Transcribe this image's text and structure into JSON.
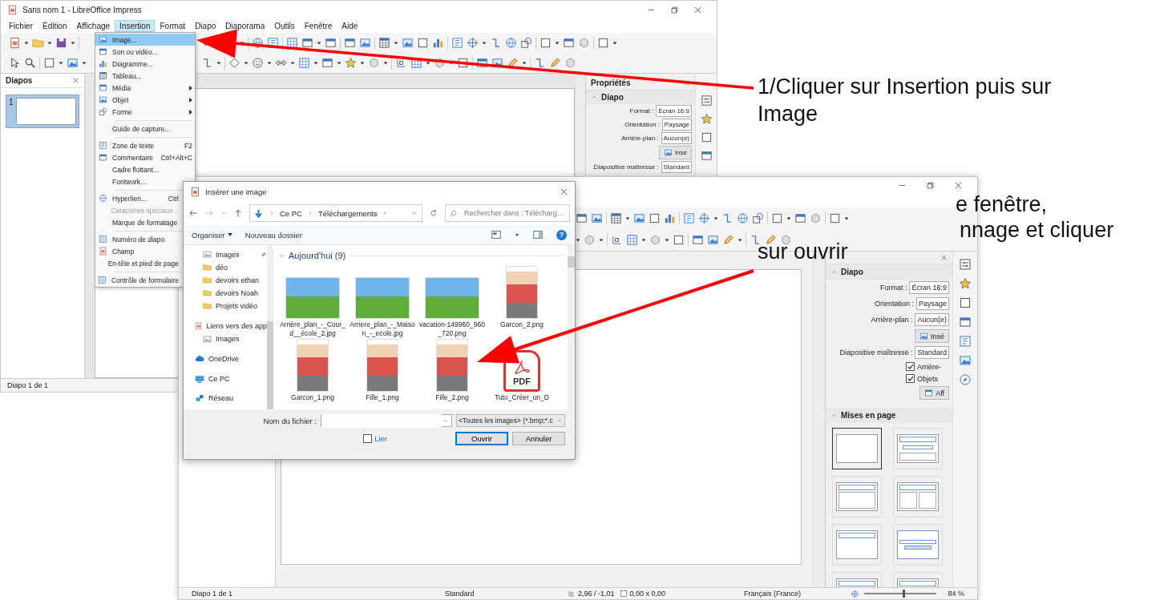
{
  "window_back": {
    "title": "Sans nom 1 - LibreOffice Impress",
    "menu": [
      {
        "label": "Fichier",
        "selected": false
      },
      {
        "label": "Édition",
        "selected": false
      },
      {
        "label": "Affichage",
        "selected": false
      },
      {
        "label": "Insertion",
        "selected": true
      },
      {
        "label": "Format",
        "selected": false
      },
      {
        "label": "Diapo",
        "selected": false
      },
      {
        "label": "Diaporama",
        "selected": false
      },
      {
        "label": "Outils",
        "selected": false
      },
      {
        "label": "Fenêtre",
        "selected": false
      },
      {
        "label": "Aide",
        "selected": false
      }
    ],
    "slides_panel": {
      "title": "Diapos",
      "slide_number": "1"
    },
    "sidebar": {
      "title": "Propriétés",
      "section": "Diapo",
      "fields": [
        {
          "label": "Format :",
          "value": "Écran 16:9"
        },
        {
          "label": "Orientation :",
          "value": "Paysage"
        },
        {
          "label": "Arrière-plan :",
          "value": "Aucun(e)"
        }
      ],
      "insert_button": "Insé",
      "master_label": "Diapositive maîtresse :",
      "master_value": "Standard"
    },
    "status_bar": {
      "slide": "Diapo 1 de 1"
    }
  },
  "insert_menu": {
    "groups": [
      [
        {
          "label": "Image...",
          "submenu": false,
          "disabled": false,
          "selected": true
        },
        {
          "label": "Son ou vidéo...",
          "submenu": false,
          "disabled": false,
          "selected": false
        },
        {
          "label": "Diagramme...",
          "submenu": false,
          "disabled": false,
          "selected": false
        },
        {
          "label": "Tableau...",
          "submenu": false,
          "disabled": false,
          "selected": false
        },
        {
          "label": "Média",
          "submenu": true,
          "disabled": false,
          "selected": false
        },
        {
          "label": "Objet",
          "submenu": true,
          "disabled": false,
          "selected": false
        },
        {
          "label": "Forme",
          "submenu": true,
          "disabled": false,
          "selected": false
        }
      ],
      [
        {
          "label": "Guide de capture...",
          "submenu": false,
          "disabled": false,
          "selected": false
        }
      ],
      [
        {
          "label": "Zone de texte",
          "shortcut": "F2",
          "submenu": false,
          "disabled": false,
          "selected": false
        },
        {
          "label": "Commentaire",
          "shortcut": "Ctrl+Alt+C",
          "submenu": false,
          "disabled": false,
          "selected": false
        },
        {
          "label": "Cadre flottant...",
          "submenu": false,
          "disabled": false,
          "selected": false
        },
        {
          "label": "Fontwork...",
          "submenu": false,
          "disabled": false,
          "selected": false
        }
      ],
      [
        {
          "label": "Hyperlien...",
          "shortcut": "Ctrl",
          "submenu": false,
          "disabled": false,
          "selected": false
        },
        {
          "label": "Caractères spéciaux...",
          "submenu": false,
          "disabled": true,
          "selected": false
        },
        {
          "label": "Marque de formatage",
          "submenu": false,
          "disabled": false,
          "selected": false
        }
      ],
      [
        {
          "label": "Numéro de diapo",
          "submenu": false,
          "disabled": false,
          "selected": false
        },
        {
          "label": "Champ",
          "submenu": false,
          "disabled": false,
          "selected": false
        },
        {
          "label": "En-tête et pied de page",
          "submenu": false,
          "disabled": false,
          "selected": false
        }
      ],
      [
        {
          "label": "Contrôle de formulaire",
          "submenu": false,
          "disabled": false,
          "selected": false
        }
      ]
    ]
  },
  "window_front": {
    "sidebar": {
      "section": "Diapo",
      "fields": [
        {
          "label": "Format :",
          "value": "Écran 16:9"
        },
        {
          "label": "Orientation :",
          "value": "Paysage"
        },
        {
          "label": "Arrière-plan :",
          "value": "Aucun(e)"
        }
      ],
      "insert_button": "Insé",
      "master_label": "Diapositive maîtresse :",
      "master_value": "Standard",
      "checkboxes": [
        {
          "label": "Arrière-",
          "checked": true
        },
        {
          "label": "Objets",
          "checked": true
        }
      ],
      "display_button": "Aff",
      "layouts_title": "Mises en page",
      "layouts": [
        {
          "kind": "blank",
          "selected": true
        },
        {
          "kind": "title-subtitle",
          "selected": false
        },
        {
          "kind": "title-content",
          "selected": false
        },
        {
          "kind": "title-two-columns",
          "selected": false
        },
        {
          "kind": "title-only",
          "selected": false
        },
        {
          "kind": "centered-text",
          "selected": false
        },
        {
          "kind": "title-split-left",
          "selected": false
        },
        {
          "kind": "title-split-right",
          "selected": false
        }
      ]
    },
    "status_bar": {
      "slide": "Diapo 1 de 1",
      "layout": "Standard",
      "position": "2,96 / -1,01",
      "size": "0,00 x 0,00",
      "language": "Français (France)",
      "zoom": "84 %",
      "zoom_slider": {
        "level": 0.53
      }
    }
  },
  "dialog": {
    "title": "Insérer une image",
    "breadcrumb": [
      "Ce PC",
      "Téléchargements"
    ],
    "search": {
      "placeholder": "Rechercher dans : Télécharg..."
    },
    "commands": [
      {
        "label": "Organiser",
        "dropdown": true
      },
      {
        "label": "Nouveau dossier",
        "dropdown": false
      }
    ],
    "help": "?",
    "quick_access": [
      {
        "label": "Images",
        "kind": "pictures",
        "pinned": true
      },
      {
        "label": "déo",
        "kind": "folder",
        "pinned": false
      },
      {
        "label": "devoirs ethan",
        "kind": "folder",
        "pinned": false
      },
      {
        "label": "devoirs Noah",
        "kind": "folder",
        "pinned": false
      },
      {
        "label": "Projets vidéo",
        "kind": "folder",
        "pinned": false
      }
    ],
    "locations": [
      {
        "label": "Liens vers des app",
        "kind": "document",
        "children": [
          {
            "label": "Images",
            "kind": "pictures"
          }
        ]
      },
      {
        "label": "OneDrive",
        "kind": "cloud"
      },
      {
        "label": "Ce PC",
        "kind": "computer"
      },
      {
        "label": "Réseau",
        "kind": "network"
      }
    ],
    "group": "Aujourd'hui (9)",
    "files": [
      {
        "name": "Arrière_plan_-_Cour_d__école_2.jpg",
        "kind": "landscape"
      },
      {
        "name": "Arriere_plan_-_Maison_-_ecole.jpg",
        "kind": "landscape"
      },
      {
        "name": "vacation-149960_960_720.png",
        "kind": "landscape"
      },
      {
        "name": "Garcon_2.png",
        "kind": "portrait"
      },
      {
        "name": "Garcon_1.png",
        "kind": "portrait"
      },
      {
        "name": "Fille_1.png",
        "kind": "portrait"
      },
      {
        "name": "Fille_2.png",
        "kind": "portrait"
      },
      {
        "name": "Tuto_Créer_un_D",
        "kind": "pdf",
        "badge": "PDF"
      }
    ],
    "filename_label": "Nom du fichier :",
    "filter": "<Toutes les images> (*.bmp;*.c",
    "link_checkbox": {
      "label": "Lier",
      "checked": false
    },
    "buttons": [
      {
        "label": "Ouvrir",
        "default": true
      },
      {
        "label": "Annuler",
        "default": false
      }
    ]
  },
  "annotations": [
    {
      "lines": [
        "1/Cliquer sur Insertion puis sur",
        "Image"
      ]
    },
    {
      "lines": [
        "e fenêtre,",
        "nnage et cliquer",
        "sur ouvrir"
      ]
    }
  ]
}
